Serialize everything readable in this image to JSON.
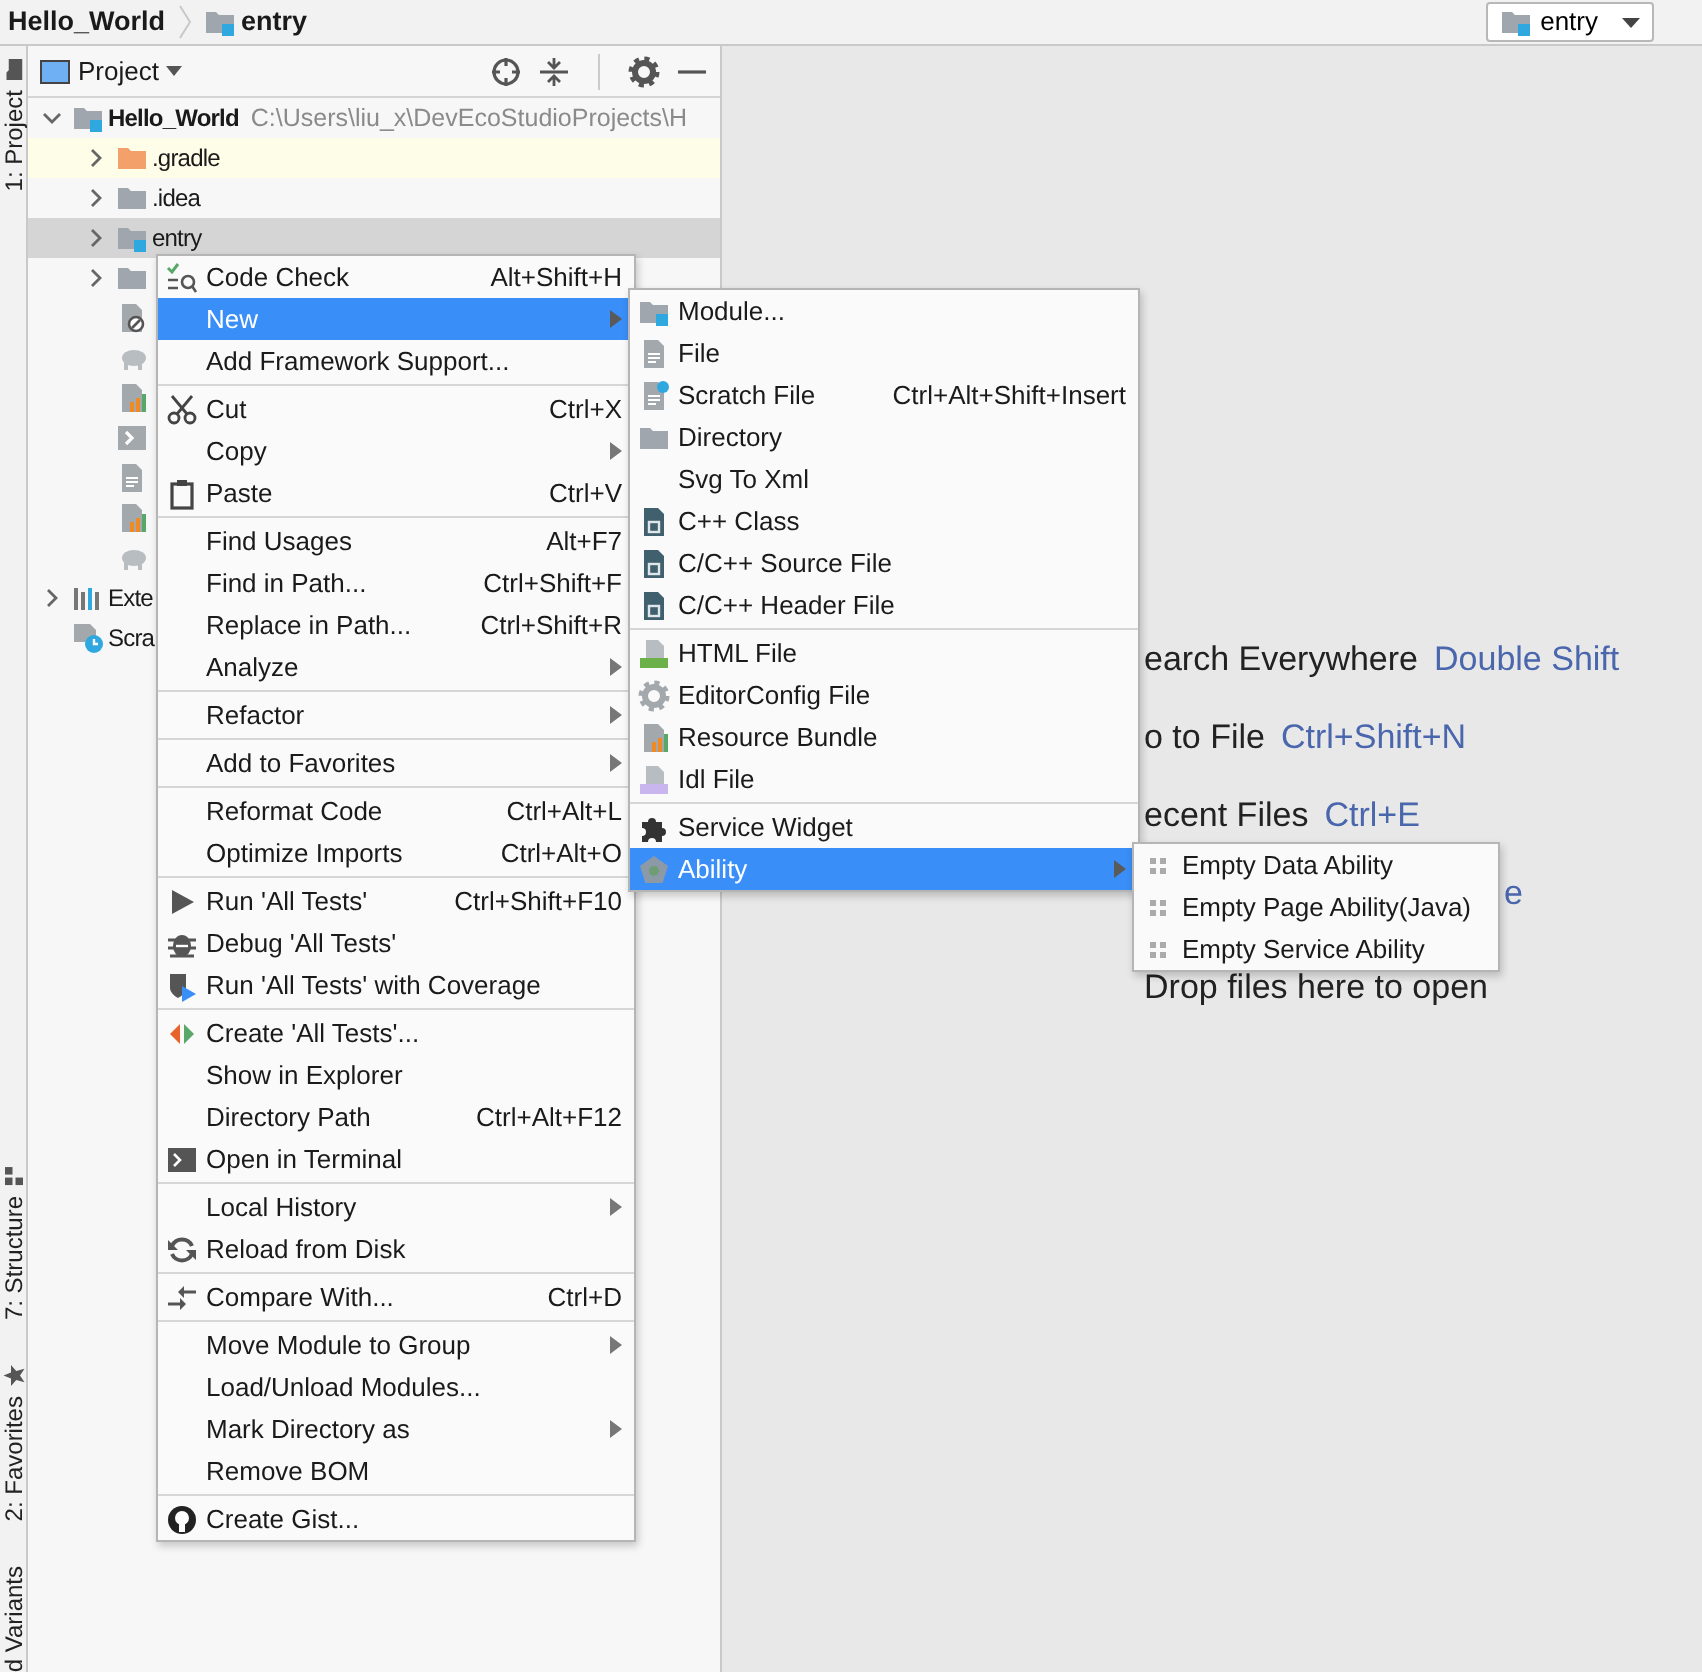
{
  "breadcrumb": [
    {
      "label": "Hello_World"
    },
    {
      "label": "entry"
    }
  ],
  "run_config": {
    "label": "entry"
  },
  "tool_strip": {
    "top": [
      {
        "label": "1: Project"
      }
    ],
    "bottom": [
      {
        "label": "7: Structure"
      },
      {
        "label": "2: Favorites"
      },
      {
        "label": "d Variants"
      }
    ]
  },
  "project_panel": {
    "title": "Project",
    "tree": [
      {
        "label": "Hello_World",
        "path": "C:\\Users\\liu_x\\DevEcoStudioProjects\\H",
        "expanded": true,
        "children": [
          {
            "label": ".gradle",
            "expanded": false,
            "selected": false,
            "excluded": true
          },
          {
            "label": ".idea",
            "expanded": false,
            "selected": false,
            "excluded": false
          },
          {
            "label": "entry",
            "expanded": false,
            "selected": true,
            "excluded": false
          },
          {
            "expanded": false,
            "selected": false,
            "excluded": false
          },
          {
            "selected": false,
            "excluded": false
          },
          {
            "selected": false,
            "excluded": false
          },
          {
            "selected": false,
            "excluded": false
          },
          {
            "selected": false,
            "excluded": false
          },
          {
            "selected": false,
            "excluded": false
          },
          {
            "selected": false,
            "excluded": false
          },
          {
            "selected": false,
            "excluded": false
          }
        ]
      },
      {
        "label": "Exte",
        "expanded": false
      },
      {
        "label": "Scra"
      }
    ]
  },
  "editor_hints": [
    {
      "parts": [
        {
          "text": "earch Everywhere",
          "kind": "text"
        },
        {
          "text": "Double Shift",
          "kind": "key"
        }
      ]
    },
    {
      "parts": [
        {
          "text": "o to File",
          "kind": "text"
        },
        {
          "text": "Ctrl+Shift+N",
          "kind": "key"
        }
      ]
    },
    {
      "parts": [
        {
          "text": "ecent Files",
          "kind": "text"
        },
        {
          "text": "Ctrl+E",
          "kind": "key"
        }
      ]
    },
    {
      "parts": [
        {
          "text": "e",
          "kind": "key"
        }
      ],
      "kind": "offset"
    },
    {
      "parts": [
        {
          "text": "Drop files here to open",
          "kind": "text"
        }
      ]
    }
  ],
  "context_menu": {
    "items": [
      {
        "kind": "item",
        "label": "Code Check",
        "shortcut": "Alt+Shift+H",
        "submenu": false,
        "selected": false
      },
      {
        "kind": "item",
        "label": "New",
        "submenu": true,
        "selected": true
      },
      {
        "kind": "item",
        "label": "Add Framework Support...",
        "submenu": false,
        "selected": false
      },
      {
        "kind": "separator"
      },
      {
        "kind": "item",
        "label": "Cut",
        "shortcut": "Ctrl+X",
        "submenu": false,
        "selected": false
      },
      {
        "kind": "item",
        "label": "Copy",
        "submenu": true,
        "selected": false
      },
      {
        "kind": "item",
        "label": "Paste",
        "shortcut": "Ctrl+V",
        "submenu": false,
        "selected": false
      },
      {
        "kind": "separator"
      },
      {
        "kind": "item",
        "label": "Find Usages",
        "shortcut": "Alt+F7",
        "submenu": false,
        "selected": false
      },
      {
        "kind": "item",
        "label": "Find in Path...",
        "shortcut": "Ctrl+Shift+F",
        "submenu": false,
        "selected": false
      },
      {
        "kind": "item",
        "label": "Replace in Path...",
        "shortcut": "Ctrl+Shift+R",
        "submenu": false,
        "selected": false
      },
      {
        "kind": "item",
        "label": "Analyze",
        "submenu": true,
        "selected": false
      },
      {
        "kind": "separator"
      },
      {
        "kind": "item",
        "label": "Refactor",
        "submenu": true,
        "selected": false
      },
      {
        "kind": "separator"
      },
      {
        "kind": "item",
        "label": "Add to Favorites",
        "submenu": true,
        "selected": false
      },
      {
        "kind": "separator"
      },
      {
        "kind": "item",
        "label": "Reformat Code",
        "shortcut": "Ctrl+Alt+L",
        "submenu": false,
        "selected": false
      },
      {
        "kind": "item",
        "label": "Optimize Imports",
        "shortcut": "Ctrl+Alt+O",
        "submenu": false,
        "selected": false
      },
      {
        "kind": "separator"
      },
      {
        "kind": "item",
        "label": "Run 'All Tests'",
        "shortcut": "Ctrl+Shift+F10",
        "submenu": false,
        "selected": false
      },
      {
        "kind": "item",
        "label": "Debug 'All Tests'",
        "submenu": false,
        "selected": false
      },
      {
        "kind": "item",
        "label": "Run 'All Tests' with Coverage",
        "submenu": false,
        "selected": false
      },
      {
        "kind": "separator"
      },
      {
        "kind": "item",
        "label": "Create 'All Tests'...",
        "submenu": false,
        "selected": false
      },
      {
        "kind": "item",
        "label": "Show in Explorer",
        "submenu": false,
        "selected": false
      },
      {
        "kind": "item",
        "label": "Directory Path",
        "shortcut": "Ctrl+Alt+F12",
        "submenu": false,
        "selected": false
      },
      {
        "kind": "item",
        "label": "Open in Terminal",
        "submenu": false,
        "selected": false
      },
      {
        "kind": "separator"
      },
      {
        "kind": "item",
        "label": "Local History",
        "submenu": true,
        "selected": false
      },
      {
        "kind": "item",
        "label": "Reload from Disk",
        "submenu": false,
        "selected": false
      },
      {
        "kind": "separator"
      },
      {
        "kind": "item",
        "label": "Compare With...",
        "shortcut": "Ctrl+D",
        "submenu": false,
        "selected": false
      },
      {
        "kind": "separator"
      },
      {
        "kind": "item",
        "label": "Move Module to Group",
        "submenu": true,
        "selected": false
      },
      {
        "kind": "item",
        "label": "Load/Unload Modules...",
        "submenu": false,
        "selected": false
      },
      {
        "kind": "item",
        "label": "Mark Directory as",
        "submenu": true,
        "selected": false
      },
      {
        "kind": "item",
        "label": "Remove BOM",
        "submenu": false,
        "selected": false
      },
      {
        "kind": "separator"
      },
      {
        "kind": "item",
        "label": "Create Gist...",
        "submenu": false,
        "selected": false
      }
    ]
  },
  "new_submenu": {
    "items": [
      {
        "kind": "item",
        "label": "Module...",
        "submenu": false,
        "selected": false
      },
      {
        "kind": "item",
        "label": "File",
        "submenu": false,
        "selected": false
      },
      {
        "kind": "item",
        "label": "Scratch File",
        "shortcut": "Ctrl+Alt+Shift+Insert",
        "submenu": false,
        "selected": false
      },
      {
        "kind": "item",
        "label": "Directory",
        "submenu": false,
        "selected": false
      },
      {
        "kind": "item",
        "label": "Svg To Xml",
        "submenu": false,
        "selected": false
      },
      {
        "kind": "item",
        "label": "C++ Class",
        "submenu": false,
        "selected": false
      },
      {
        "kind": "item",
        "label": "C/C++ Source File",
        "submenu": false,
        "selected": false
      },
      {
        "kind": "item",
        "label": "C/C++ Header File",
        "submenu": false,
        "selected": false
      },
      {
        "kind": "separator"
      },
      {
        "kind": "item",
        "label": "HTML File",
        "submenu": false,
        "selected": false
      },
      {
        "kind": "item",
        "label": "EditorConfig File",
        "submenu": false,
        "selected": false
      },
      {
        "kind": "item",
        "label": "Resource Bundle",
        "submenu": false,
        "selected": false
      },
      {
        "kind": "item",
        "label": "Idl File",
        "submenu": false,
        "selected": false
      },
      {
        "kind": "separator"
      },
      {
        "kind": "item",
        "label": "Service Widget",
        "submenu": false,
        "selected": false
      },
      {
        "kind": "item",
        "label": "Ability",
        "submenu": true,
        "selected": true
      }
    ]
  },
  "ability_submenu": {
    "items": [
      {
        "kind": "item",
        "label": "Empty Data Ability",
        "submenu": false,
        "selected": false
      },
      {
        "kind": "item",
        "label": "Empty Page Ability(Java)",
        "submenu": false,
        "selected": false
      },
      {
        "kind": "item",
        "label": "Empty Service Ability",
        "submenu": false,
        "selected": false
      }
    ]
  }
}
